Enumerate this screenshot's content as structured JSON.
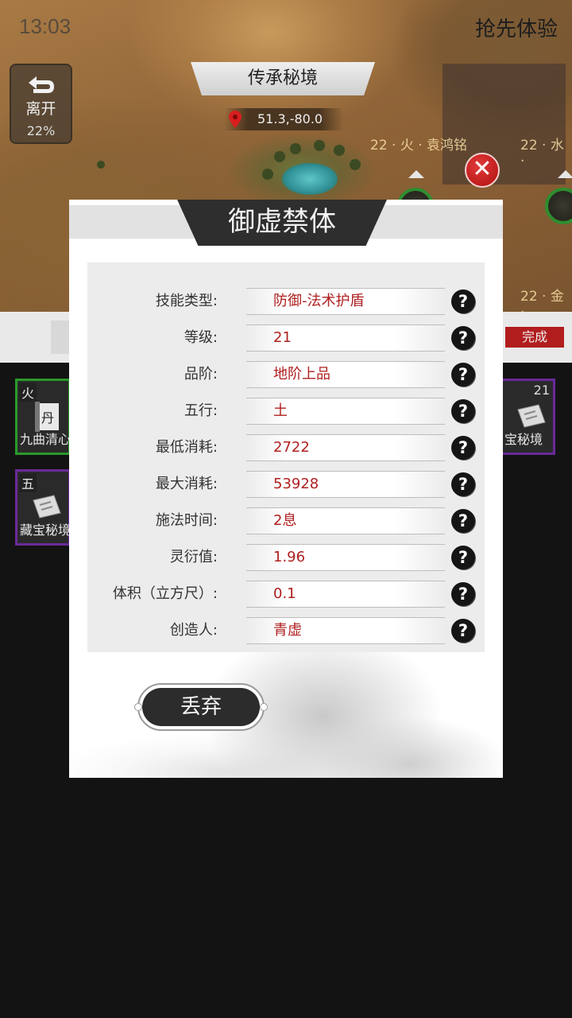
{
  "status_bar": {
    "time": "13:03",
    "early_access": "抢先体验"
  },
  "map": {
    "leave": {
      "label": "离开",
      "percent": "22%"
    },
    "location_name": "传承秘境",
    "coordinates": "51.3,-80.0",
    "nodes": [
      {
        "label": "22 · 火 · 袁鸿铭"
      },
      {
        "label": "22 · 水 · "
      },
      {
        "label": "22 · 金 · "
      }
    ]
  },
  "background_panel": {
    "done_label": "完成",
    "items": [
      {
        "tag": "火",
        "name": "九曲清心",
        "level": "",
        "border": "#2a9a2a"
      },
      {
        "tag": "",
        "name": "宝秘境",
        "level": "21",
        "border": "#6a2a9a"
      },
      {
        "tag": "五",
        "name": "藏宝秘境",
        "level": "",
        "border": "#6a2a9a"
      }
    ]
  },
  "modal": {
    "title": "御虚禁体",
    "attributes": [
      {
        "label": "技能类型:",
        "value": "防御-法术护盾"
      },
      {
        "label": "等级:",
        "value": "21"
      },
      {
        "label": "品阶:",
        "value": "地阶上品"
      },
      {
        "label": "五行:",
        "value": "土"
      },
      {
        "label": "最低消耗:",
        "value": "2722"
      },
      {
        "label": "最大消耗:",
        "value": "53928"
      },
      {
        "label": "施法时间:",
        "value": "2息"
      },
      {
        "label": "灵衍值:",
        "value": "1.96"
      },
      {
        "label": "体积（立方尺）:",
        "value": "0.1"
      },
      {
        "label": "创造人:",
        "value": "青虚"
      }
    ],
    "help_icon_glyph": "?",
    "discard_label": "丢弃"
  },
  "colors": {
    "value_text": "#b02020",
    "modal_title_bg": "#2e2e2e",
    "close_button": "#c81c1c"
  }
}
